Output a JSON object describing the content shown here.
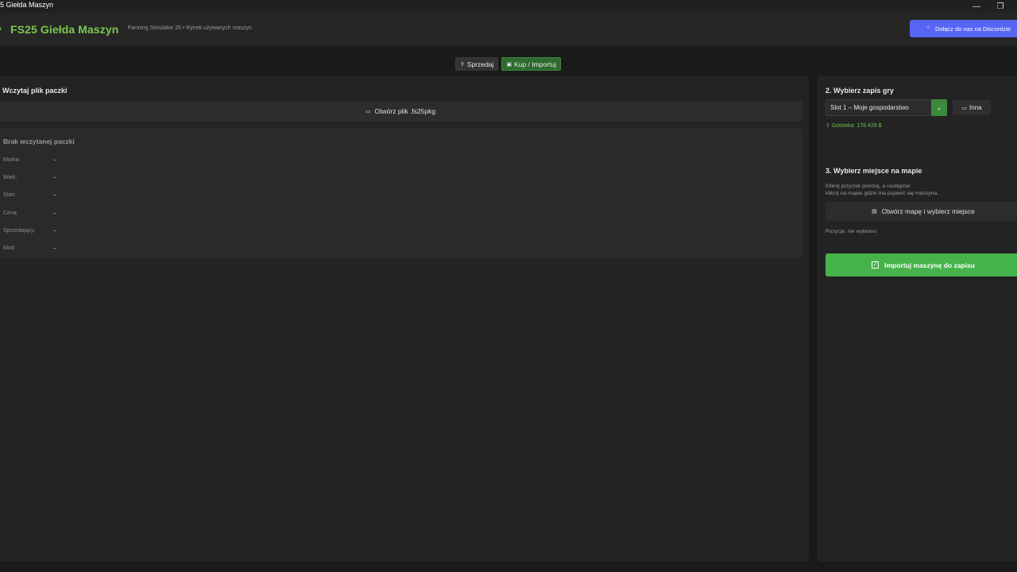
{
  "window": {
    "title": "5 Giełda Maszyn",
    "minimize_icon": "minimize-icon",
    "restore_icon": "restore-icon"
  },
  "header": {
    "title": "FS25 Giełda Maszyn",
    "subtitle": "Farming Simulator 25 • Rynek używanych maszyn",
    "discord_label": "Dołącz do nas na Discordzie",
    "discord_color": "#5865f2",
    "brand_color": "#7bc74d"
  },
  "tabs": [
    {
      "label": "Sprzedaj",
      "icon": "upload-icon",
      "active": false
    },
    {
      "label": "Kup / Importuj",
      "icon": "import-icon",
      "active": true
    }
  ],
  "left": {
    "section_title": ". Wczytaj plik paczki",
    "open_file_label": "Otwórz plik .fs25pkg",
    "package": {
      "title": "Brak wczytanej paczki",
      "rows": [
        {
          "key": "Marka:",
          "value": "–"
        },
        {
          "key": "Wiek:",
          "value": "–"
        },
        {
          "key": "Stan:",
          "value": "–"
        },
        {
          "key": "Cena:",
          "value": "–"
        },
        {
          "key": "Sprzedający:",
          "value": "–"
        },
        {
          "key": "Mod:",
          "value": "–"
        }
      ]
    }
  },
  "right": {
    "save_title": "2. Wybierz zapis gry",
    "save_selected": "Slot 1 – Moje gospodarstwo",
    "other_label": "Inna",
    "cash": "Gotówka: 178 428 $",
    "map_title": "3. Wybierz miejsce na mapie",
    "hint_line1": "Kliknij przycisk poniżej, a następnie",
    "hint_line2": "kliknij na mapie gdzie ma pojawić się maszyna.",
    "map_button": "Otwórz mapę i wybierz miejsce",
    "position": "Pozycja: nie wybrano",
    "import_button": "Importuj maszynę do zapisu",
    "accent_color": "#46b34a"
  }
}
